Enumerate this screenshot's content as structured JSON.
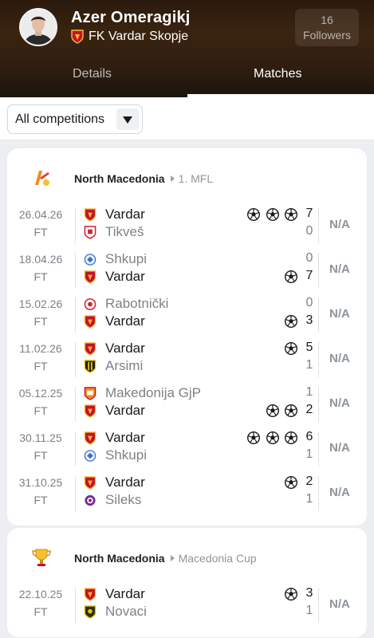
{
  "player": {
    "name": "Azer Omeragikj",
    "club": "FK Vardar Skopje",
    "followers_count": "16",
    "followers_label": "Followers"
  },
  "tabs": {
    "details": "Details",
    "matches": "Matches"
  },
  "filter": {
    "selected": "All competitions"
  },
  "colors": {
    "header_bg": "#2e1d10",
    "page_bg": "#eceef1",
    "vardar_red": "#c8102e",
    "vardar_gold": "#f2c230"
  },
  "competitions": [
    {
      "icon": "north-macedonia-first-league-icon",
      "country": "North Macedonia",
      "league": "1. MFL",
      "matches": [
        {
          "date": "26.04.26",
          "status": "FT",
          "home": "Vardar",
          "away": "Tikveš",
          "home_score": "7",
          "away_score": "0",
          "home_goals": 3,
          "away_goals": 0,
          "player_team": "home",
          "rating": "N/A"
        },
        {
          "date": "18.04.26",
          "status": "FT",
          "home": "Shkupi",
          "away": "Vardar",
          "home_score": "0",
          "away_score": "7",
          "home_goals": 0,
          "away_goals": 1,
          "player_team": "away",
          "rating": "N/A"
        },
        {
          "date": "15.02.26",
          "status": "FT",
          "home": "Rabotnički",
          "away": "Vardar",
          "home_score": "0",
          "away_score": "3",
          "home_goals": 0,
          "away_goals": 1,
          "player_team": "away",
          "rating": "N/A"
        },
        {
          "date": "11.02.26",
          "status": "FT",
          "home": "Vardar",
          "away": "Arsimi",
          "home_score": "5",
          "away_score": "1",
          "home_goals": 1,
          "away_goals": 0,
          "player_team": "home",
          "rating": "N/A"
        },
        {
          "date": "05.12.25",
          "status": "FT",
          "home": "Makedonija GjP",
          "away": "Vardar",
          "home_score": "1",
          "away_score": "2",
          "home_goals": 0,
          "away_goals": 2,
          "player_team": "away",
          "rating": "N/A"
        },
        {
          "date": "30.11.25",
          "status": "FT",
          "home": "Vardar",
          "away": "Shkupi",
          "home_score": "6",
          "away_score": "1",
          "home_goals": 3,
          "away_goals": 0,
          "player_team": "home",
          "rating": "N/A"
        },
        {
          "date": "31.10.25",
          "status": "FT",
          "home": "Vardar",
          "away": "Sileks",
          "home_score": "2",
          "away_score": "1",
          "home_goals": 1,
          "away_goals": 0,
          "player_team": "home",
          "rating": "N/A"
        }
      ]
    },
    {
      "icon": "macedonia-cup-trophy-icon",
      "country": "North Macedonia",
      "league": "Macedonia Cup",
      "matches": [
        {
          "date": "22.10.25",
          "status": "FT",
          "home": "Vardar",
          "away": "Novaci",
          "home_score": "3",
          "away_score": "1",
          "home_goals": 1,
          "away_goals": 0,
          "player_team": "home",
          "rating": "N/A"
        }
      ]
    }
  ]
}
